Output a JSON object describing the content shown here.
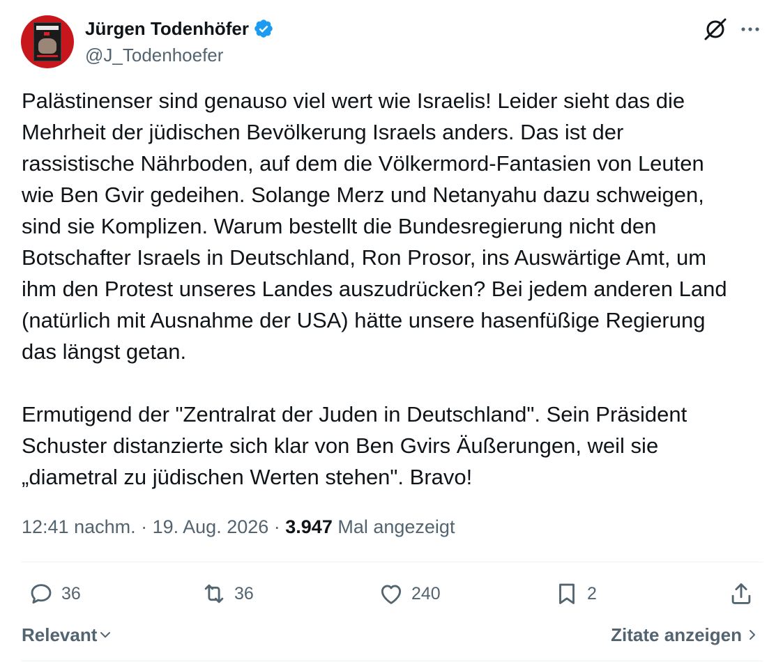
{
  "author": {
    "display_name": "Jürgen Todenhöfer",
    "handle": "@J_Todenhoefer",
    "verified": true,
    "verified_color": "#1d9bf0",
    "avatar_bg": "#c8161d"
  },
  "header_icons": [
    "grok-icon",
    "more-icon"
  ],
  "tweet": {
    "paragraph_1": "Palästinenser sind genauso viel wert wie Israelis! Leider sieht das die\nMehrheit der jüdischen Bevölkerung Israels anders. Das ist der\nrassistische Nährboden, auf dem die Völkermord-Fantasien von Leuten\nwie Ben Gvir gedeihen. Solange Merz und Netanyahu dazu schweigen,\nsind sie Komplizen. Warum bestellt die Bundesregierung nicht den\nBotschafter Israels in Deutschland, Ron Prosor, ins Auswärtige Amt, um\nihm den Protest unseres Landes auszudrücken? Bei jedem anderen Land\n(natürlich mit Ausnahme der USA) hätte unsere hasenfüßige Regierung\ndas längst getan.",
    "paragraph_2": "Ermutigend der \"Zentralrat der Juden in Deutschland\". Sein Präsident\nSchuster distanzierte sich klar von Ben Gvirs Äußerungen, weil sie\n„diametral zu jüdischen Werten stehen\". Bravo!"
  },
  "meta": {
    "time": "12:41 nachm.",
    "separator": " · ",
    "date": "19. Aug. 2026",
    "views_count": "3.947",
    "views_label": " Mal angezeigt"
  },
  "actions": {
    "replies": "36",
    "reposts": "36",
    "likes": "240",
    "bookmarks": "2"
  },
  "footer": {
    "sort_label": "Relevant",
    "quotes_label": "Zitate anzeigen"
  }
}
